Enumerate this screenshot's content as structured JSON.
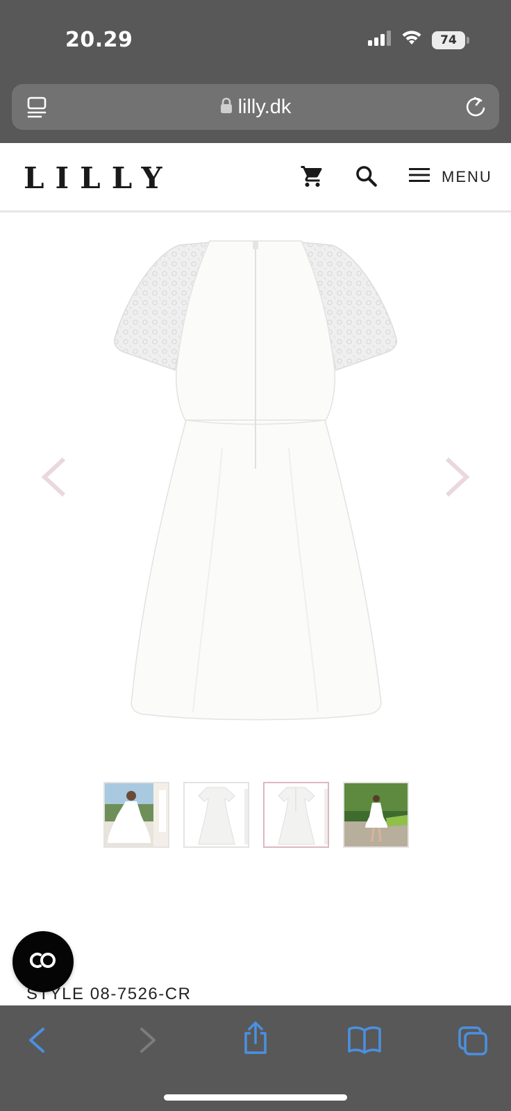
{
  "status_bar": {
    "time": "20.29",
    "battery": "74",
    "icons": [
      "signal-icon",
      "wifi-icon",
      "battery-icon"
    ]
  },
  "browser": {
    "url": "lilly.dk",
    "icons": [
      "reader-icon",
      "lock-icon",
      "reload-icon"
    ]
  },
  "site_header": {
    "logo": "LILLY",
    "menu_label": "MENU",
    "icons": [
      "cart-icon",
      "search-icon",
      "hamburger-icon"
    ]
  },
  "product": {
    "style_code": "STYLE 08-7526-CR",
    "thumbnails": [
      {
        "name": "thumbnail-model-front",
        "active": false
      },
      {
        "name": "thumbnail-dress-front",
        "active": false
      },
      {
        "name": "thumbnail-dress-back",
        "active": true
      },
      {
        "name": "thumbnail-model-outdoor",
        "active": false
      }
    ]
  },
  "toolbar": {
    "icons": [
      "back-icon",
      "forward-icon",
      "share-icon",
      "bookmarks-icon",
      "tabs-icon"
    ]
  },
  "colors": {
    "safari_chrome": "#585858",
    "url_bar": "#727272",
    "toolbar_accent": "#4a90e2",
    "carousel_arrow": "#ead8dc",
    "active_thumb_border": "#d9b9c0"
  }
}
